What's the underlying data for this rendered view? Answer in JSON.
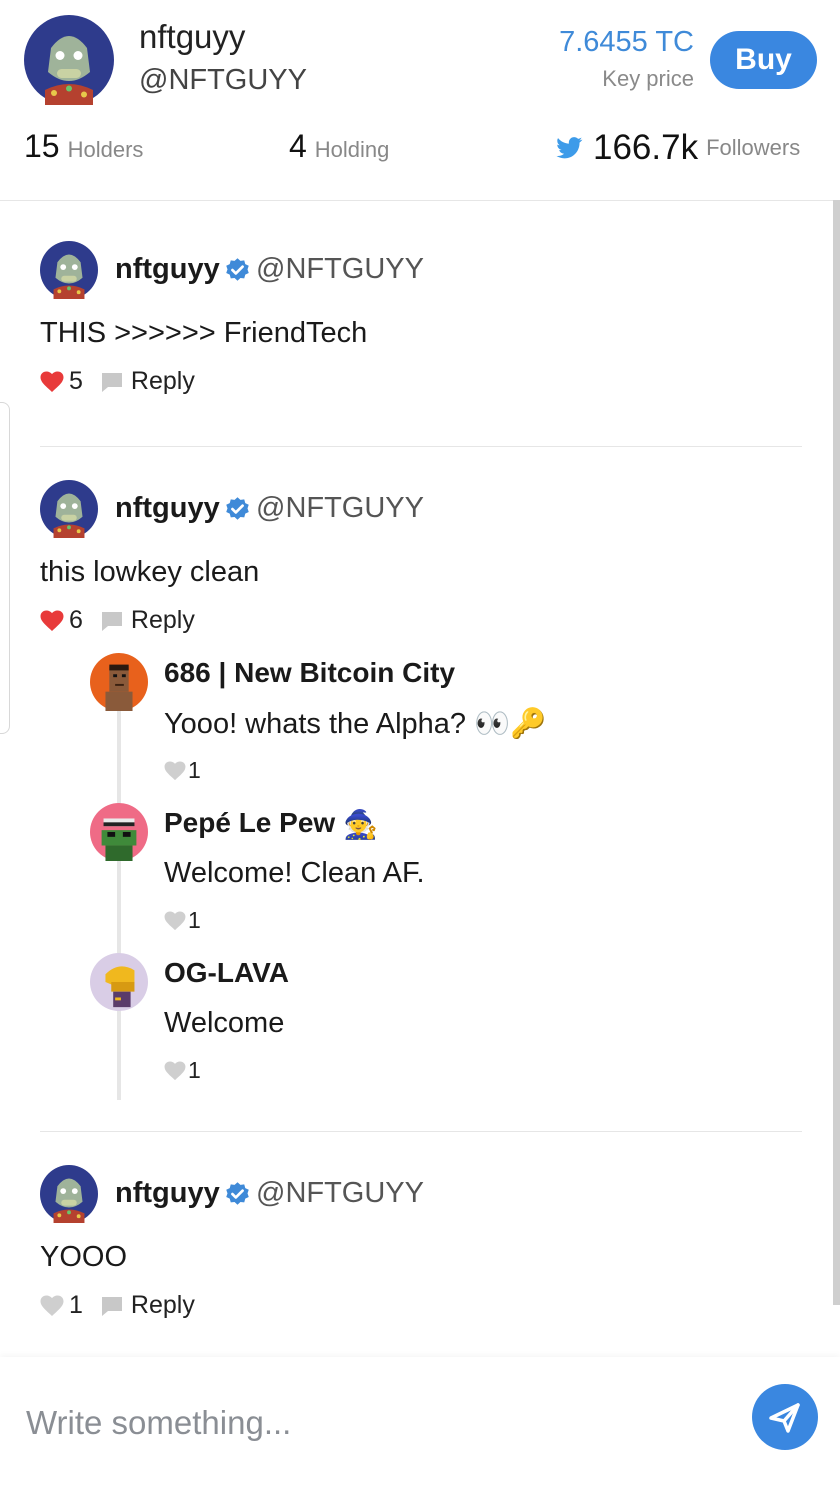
{
  "profile": {
    "name": "nftguyy",
    "handle": "@NFTGUYY",
    "key_price": "7.6455 TC",
    "key_price_label": "Key price",
    "buy_label": "Buy",
    "holders_count": "15",
    "holders_label": "Holders",
    "holding_count": "4",
    "holding_label": "Holding",
    "followers_count": "166.7k",
    "followers_label": "Followers",
    "twitter_icon": "twitter-bird-icon"
  },
  "colors": {
    "accent": "#3a87e0",
    "like_red": "#e83a3a",
    "like_gray": "#cfcfcf",
    "verified_blue": "#3f8ad8"
  },
  "posts": [
    {
      "author": "nftguyy",
      "handle": "@NFTGUYY",
      "verified": true,
      "text": "THIS >>>>>> FriendTech",
      "likes": "5",
      "liked": true,
      "reply_label": "Reply"
    },
    {
      "author": "nftguyy",
      "handle": "@NFTGUYY",
      "verified": true,
      "text": "this lowkey clean",
      "likes": "6",
      "liked": true,
      "reply_label": "Reply",
      "replies": [
        {
          "author": "686 | New Bitcoin City",
          "text": "Yooo! whats the Alpha? 👀🔑",
          "likes": "1"
        },
        {
          "author": "Pepé Le Pew",
          "author_emoji": "🧙",
          "text": "Welcome! Clean AF.",
          "likes": "1"
        },
        {
          "author": "OG-LAVA",
          "text": "Welcome",
          "likes": "1"
        }
      ]
    },
    {
      "author": "nftguyy",
      "handle": "@NFTGUYY",
      "verified": true,
      "text": "YOOO",
      "likes": "1",
      "liked": false,
      "reply_label": "Reply"
    }
  ],
  "composer": {
    "placeholder": "Write something...",
    "send_icon": "send-icon"
  }
}
